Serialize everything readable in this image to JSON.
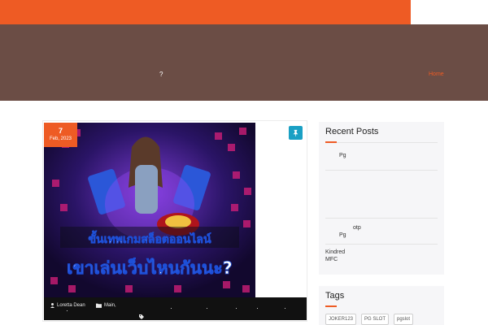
{
  "hero": {
    "title": "?",
    "breadcrumb": "Home"
  },
  "post": {
    "date_day": "7",
    "date_month": "Feb, 2023",
    "image_text_line1": "ขั้นเทพเกมสล็อตออนไลน์",
    "image_text_line2": "เขาเล่นเว็บไหนกันนะ?",
    "author": "Loretta Dean",
    "category": "Main,"
  },
  "sidebar": {
    "recent_posts": {
      "title": "Recent Posts",
      "items": [
        "Pg",
        "otp",
        "Pg",
        "Kindred MFC"
      ]
    },
    "tags": {
      "title": "Tags",
      "items": [
        "JOKER123",
        "PG SLOT",
        "pgslot"
      ]
    }
  },
  "colors": {
    "accent": "#ee5b24",
    "hero_bg": "#6b4d45",
    "pin": "#1aa0c4"
  }
}
